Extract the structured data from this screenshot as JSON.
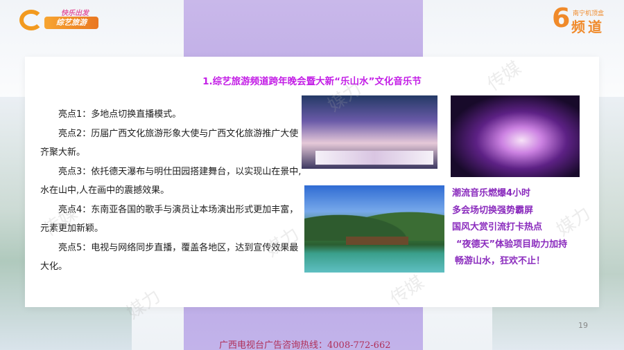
{
  "header": {
    "logo_top": "快乐出发",
    "logo_main": "综艺旅游",
    "brand_six": "6",
    "brand_sub": "南宁机顶盒",
    "brand_main": "频道"
  },
  "slide": {
    "title": "1.综艺旅游频道跨年晚会暨大新“乐山水”文化音乐节",
    "points": [
      "亮点1：多地点切换直播模式。",
      "亮点2：历届广西文化旅游形象大使与广西文化旅游推广大使齐聚大新。",
      "亮点3：依托德天瀑布与明仕田园搭建舞台，以实现山在景中,水在山中,人在画中的震撼效果。",
      "亮点4：东南亚各国的歌手与演员让本场演出形式更加丰富，元素更加新颖。",
      "亮点5：电视与网络同步直播，覆盖各地区，达到宣传效果最大化。"
    ],
    "highlights": [
      "潮流音乐燃爆4小时",
      "多会场切换强势霸屏",
      "国风大赏引流打卡热点",
      "“夜德天”体验项目助力加持",
      "畅游山水，狂欢不止！"
    ],
    "page_number": "19"
  },
  "footer": {
    "hotline": "广西电视台广告咨询热线：4008-772-662"
  },
  "watermark": {
    "text_a": "媒力",
    "text_b": "传媒"
  },
  "colors": {
    "title": "#c31ee6",
    "highlight": "#8a2bbd",
    "brand_orange": "#f08a2a",
    "band_purple": "#b6a3e3"
  }
}
